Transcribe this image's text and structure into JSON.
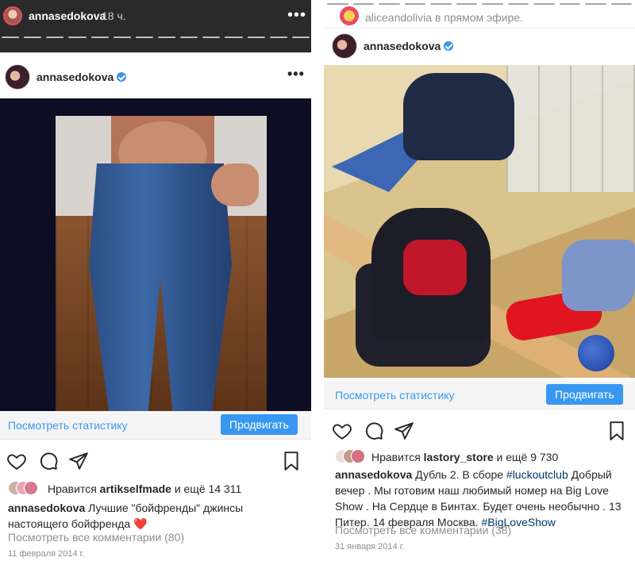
{
  "left": {
    "story": {
      "username": "annasedokova",
      "time": "18 ч.",
      "menu": "•••"
    },
    "post": {
      "username": "annasedokova",
      "menu": "•••",
      "stats_link": "Посмотреть статистику",
      "promote_button": "Продвигать",
      "likes_prefix": "Нравится",
      "likes_user": "artikselfmade",
      "likes_suffix": "и ещё 14 311",
      "caption_user": "annasedokova",
      "caption_text": "Лучшие \"бойфренды\" джинсы настоящего бойфренда",
      "caption_emoji": "❤️",
      "comments_link": "Посмотреть все комментарии (80)",
      "date": "11 февраля 2014 г."
    }
  },
  "right": {
    "live": {
      "text": "aliceandolivia в прямом эфире."
    },
    "post": {
      "username": "annasedokova",
      "menu": "•••",
      "stats_link": "Посмотреть статистику",
      "promote_button": "Продвигать",
      "likes_prefix": "Нравится",
      "likes_user": "lastory_store",
      "likes_suffix": "и ещё 9 730",
      "caption_user": "annasedokova",
      "caption_text_1": "Дубль 2. В сборе",
      "caption_hashtag_1": "#luckoutclub",
      "caption_text_2": "Добрый вечер . Мы готовим наш любимый номер на Big Love Show . На Сердце в Бинтах. Будет очень необычно . 13 Питер. 14 февраля Москва.",
      "caption_hashtag_2": "#BigLoveShow",
      "comments_link": "Посмотреть все комментарии (38)",
      "date": "31 января 2014 г."
    }
  },
  "colors": {
    "accent": "#3897f0",
    "dark_bar": "#2a2a2a",
    "text": "#262626",
    "muted": "#8e8e8e",
    "like_red": "#ed4956"
  },
  "icons": [
    "heart-icon",
    "comment-icon",
    "share-icon",
    "bookmark-icon",
    "verified-icon",
    "more-icon"
  ]
}
